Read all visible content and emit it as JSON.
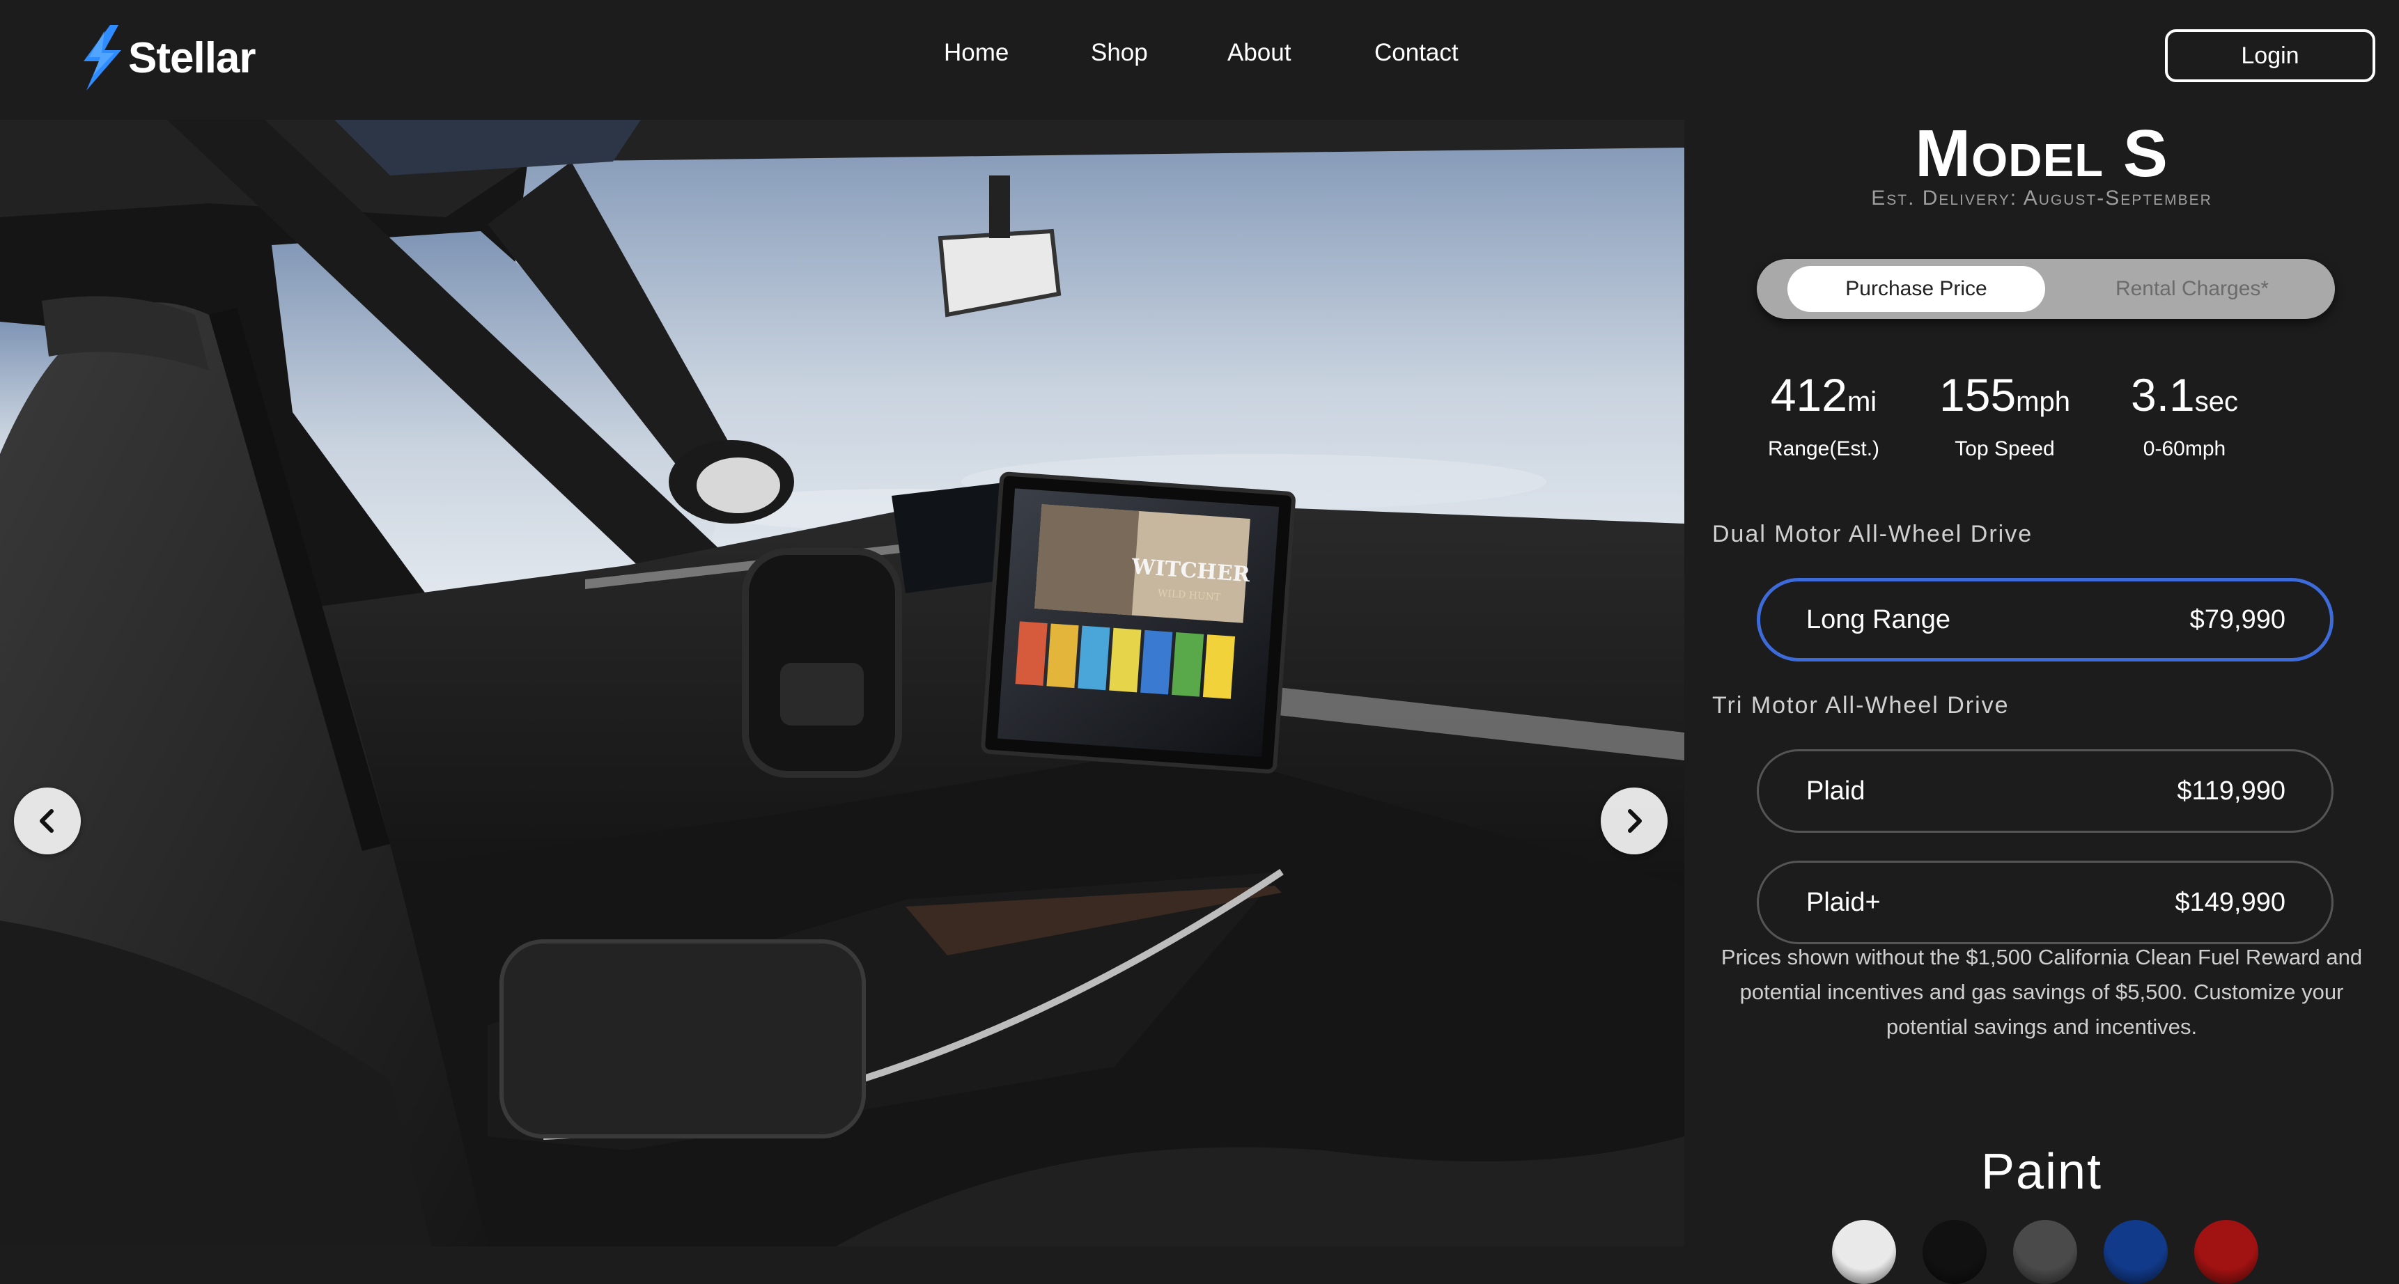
{
  "header": {
    "logo_text": "Stellar",
    "nav": [
      "Home",
      "Shop",
      "About",
      "Contact"
    ],
    "login_label": "Login"
  },
  "hero": {
    "screen_title": "WITCHER",
    "screen_subtitle": "WILD HUNT"
  },
  "model": {
    "name": "Model S",
    "delivery": "Est. Delivery: August-September"
  },
  "price_toggle": {
    "options": [
      "Purchase Price",
      "Rental Charges*"
    ],
    "selected": "Purchase Price"
  },
  "stats": [
    {
      "value": "412",
      "unit": "mi",
      "label": "Range(Est.)"
    },
    {
      "value": "155",
      "unit": "mph",
      "label": "Top Speed"
    },
    {
      "value": "3.1",
      "unit": "sec",
      "label": "0-60mph"
    }
  ],
  "drive_groups": [
    {
      "label": "Dual Motor All-Wheel Drive"
    },
    {
      "label": "Tri Motor All-Wheel Drive"
    }
  ],
  "trims": [
    {
      "name": "Long Range",
      "price": "$79,990",
      "selected": true
    },
    {
      "name": "Plaid",
      "price": "$119,990",
      "selected": false
    },
    {
      "name": "Plaid+",
      "price": "$149,990",
      "selected": false
    }
  ],
  "disclaimer": "Prices shown without the $1,500 California Clean Fuel Reward and potential incentives and gas savings of $5,500. Customize your potential savings and incentives.",
  "paint": {
    "title": "Paint",
    "colors": [
      "#e9e9e9",
      "#111111",
      "#4a4a4a",
      "#123a8a",
      "#a11212"
    ]
  },
  "colors": {
    "background": "#1c1c1c",
    "accent": "#3d6bd9",
    "logo_blue": "#2f8cff"
  }
}
